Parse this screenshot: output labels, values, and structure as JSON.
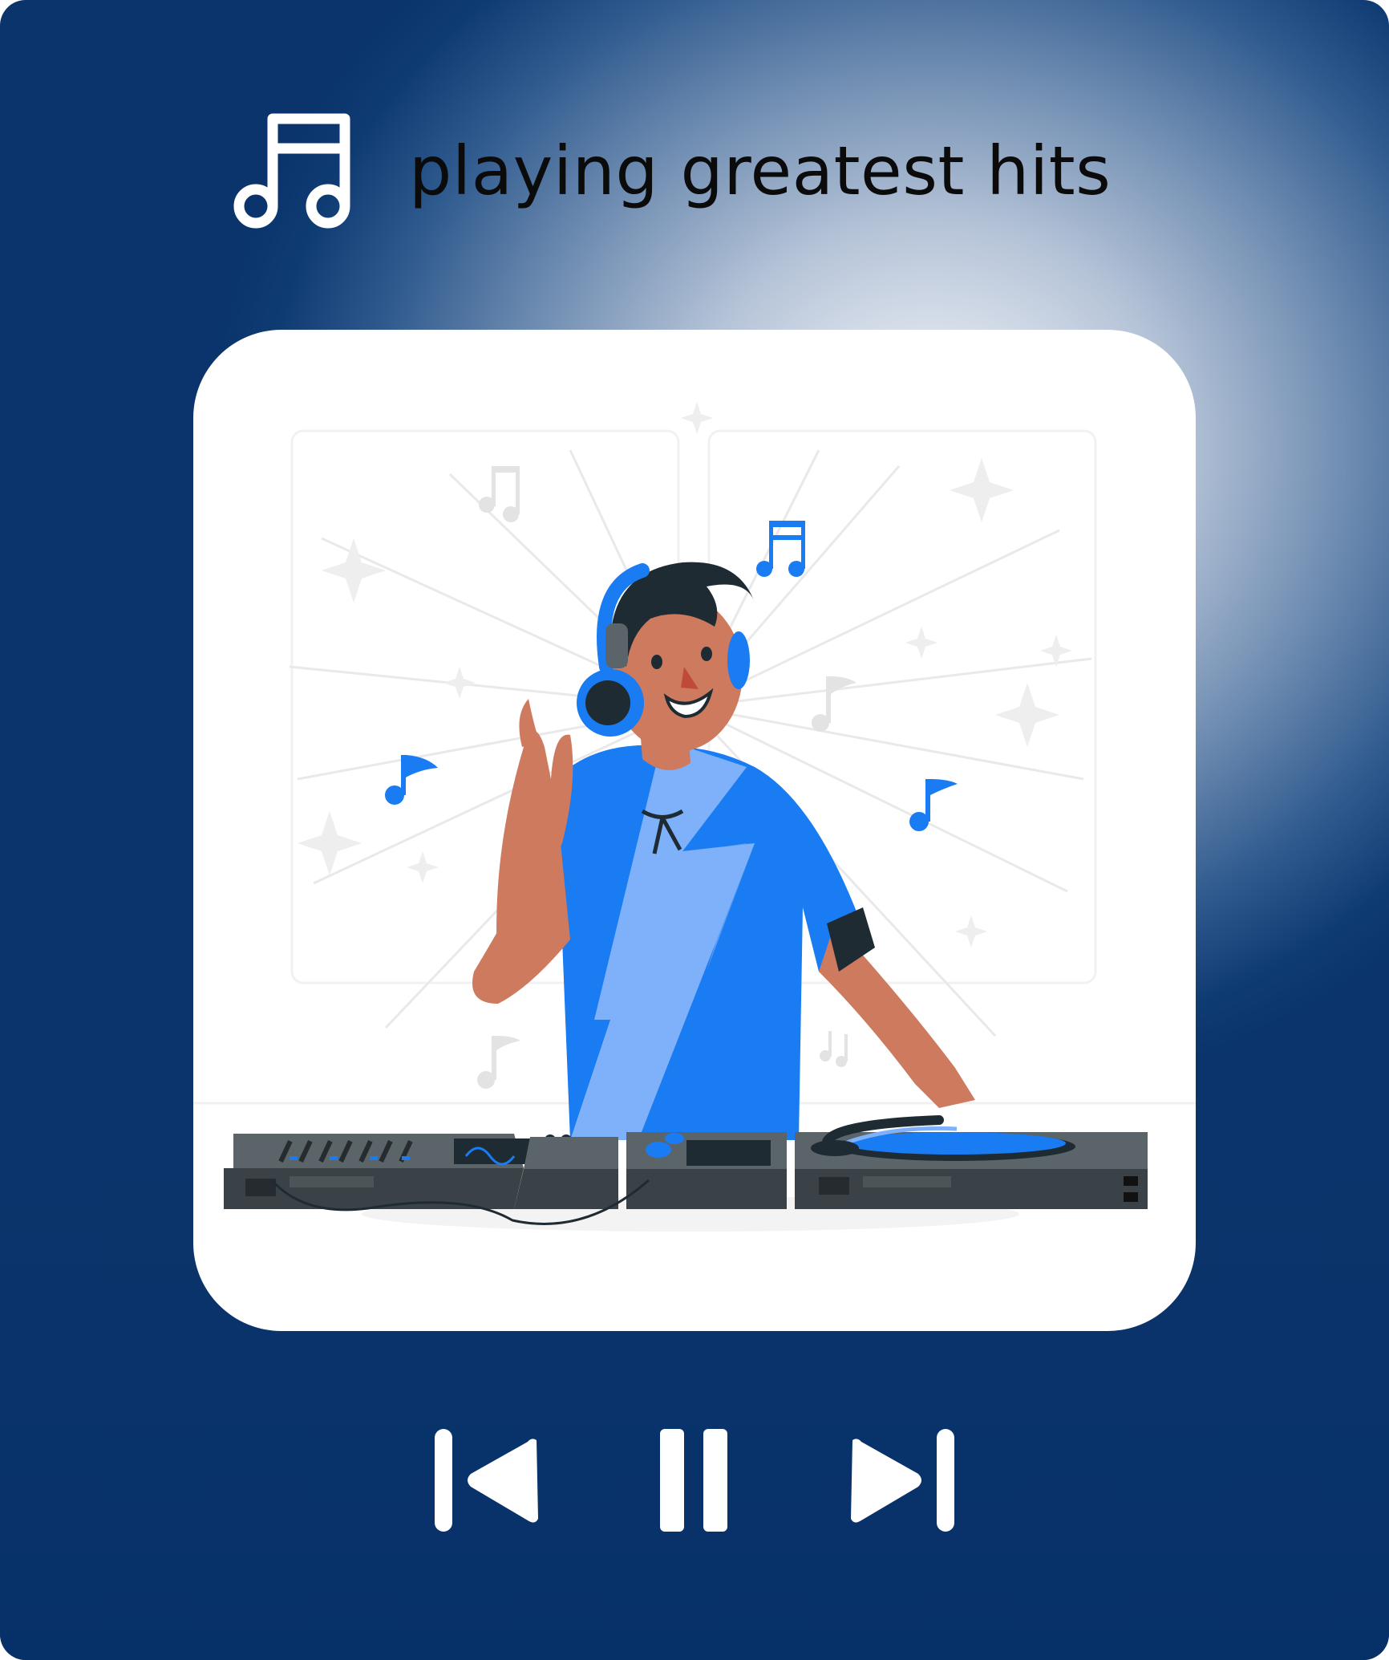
{
  "header": {
    "icon": "music-note-icon",
    "title": "playing greatest hits"
  },
  "artwork": {
    "subject": "dj-illustration",
    "colors": {
      "accent": "#1a7cf2",
      "accent_light": "#7eb1fa",
      "skin": "#cd7a5f",
      "hair": "#1f2b33",
      "deck": "#5b6469",
      "deck_dark": "#3a4247"
    }
  },
  "controls": {
    "previous": {
      "icon": "skip-previous-icon"
    },
    "pause": {
      "icon": "pause-icon"
    },
    "next": {
      "icon": "skip-next-icon"
    }
  },
  "theme": {
    "background_dark": "#0a346b",
    "background_light": "#f4f6fa",
    "control_color": "#ffffff"
  }
}
